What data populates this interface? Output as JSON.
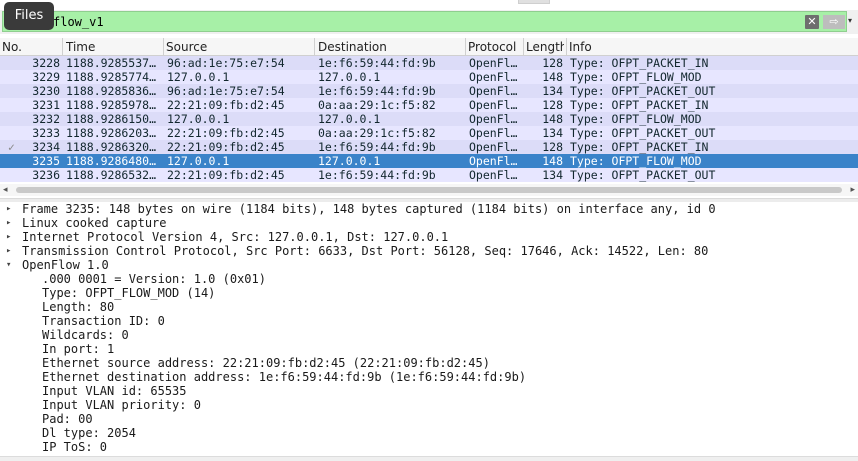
{
  "tooltip": {
    "label": "Files"
  },
  "filter": {
    "value": "flow_v1",
    "clear_icon": "✕",
    "apply_icon": "⇨",
    "dropdown_icon": "▾",
    "bg_color": "#a7f0a7"
  },
  "columns": [
    "No.",
    "Time",
    "Source",
    "Destination",
    "Protocol",
    "Length",
    "Info"
  ],
  "packets": [
    {
      "no": "3228",
      "time": "1188.9285537…",
      "src": "96:ad:1e:75:e7:54",
      "dst": "1e:f6:59:44:fd:9b",
      "proto": "OpenFl…",
      "len": "128",
      "info": "Type: OFPT_PACKET_IN",
      "bg": "#dcdcf8",
      "fg": "#12272e",
      "mark": ""
    },
    {
      "no": "3229",
      "time": "1188.9285774…",
      "src": "127.0.0.1",
      "dst": "127.0.0.1",
      "proto": "OpenFl…",
      "len": "148",
      "info": "Type: OFPT_FLOW_MOD",
      "bg": "#e7e6ff",
      "fg": "#12272e",
      "mark": ""
    },
    {
      "no": "3230",
      "time": "1188.9285836…",
      "src": "96:ad:1e:75:e7:54",
      "dst": "1e:f6:59:44:fd:9b",
      "proto": "OpenFl…",
      "len": "134",
      "info": "Type: OFPT_PACKET_OUT",
      "bg": "#dcdcf8",
      "fg": "#12272e",
      "mark": ""
    },
    {
      "no": "3231",
      "time": "1188.9285978…",
      "src": "22:21:09:fb:d2:45",
      "dst": "0a:aa:29:1c:f5:82",
      "proto": "OpenFl…",
      "len": "128",
      "info": "Type: OFPT_PACKET_IN",
      "bg": "#e7e6ff",
      "fg": "#12272e",
      "mark": ""
    },
    {
      "no": "3232",
      "time": "1188.9286150…",
      "src": "127.0.0.1",
      "dst": "127.0.0.1",
      "proto": "OpenFl…",
      "len": "148",
      "info": "Type: OFPT_FLOW_MOD",
      "bg": "#dcdcf8",
      "fg": "#12272e",
      "mark": ""
    },
    {
      "no": "3233",
      "time": "1188.9286203…",
      "src": "22:21:09:fb:d2:45",
      "dst": "0a:aa:29:1c:f5:82",
      "proto": "OpenFl…",
      "len": "134",
      "info": "Type: OFPT_PACKET_OUT",
      "bg": "#e7e6ff",
      "fg": "#12272e",
      "mark": ""
    },
    {
      "no": "3234",
      "time": "1188.9286320…",
      "src": "22:21:09:fb:d2:45",
      "dst": "1e:f6:59:44:fd:9b",
      "proto": "OpenFl…",
      "len": "128",
      "info": "Type: OFPT_PACKET_IN",
      "bg": "#dcdcf8",
      "fg": "#12272e",
      "mark": "✓"
    },
    {
      "no": "3235",
      "time": "1188.9286480…",
      "src": "127.0.0.1",
      "dst": "127.0.0.1",
      "proto": "OpenFl…",
      "len": "148",
      "info": "Type: OFPT_FLOW_MOD",
      "bg": "#3a83c9",
      "fg": "#ffffff",
      "mark": ""
    },
    {
      "no": "3236",
      "time": "1188.9286532…",
      "src": "22:21:09:fb:d2:45",
      "dst": "1e:f6:59:44:fd:9b",
      "proto": "OpenFl…",
      "len": "134",
      "info": "Type: OFPT_PACKET_OUT",
      "bg": "#e7e6ff",
      "fg": "#12272e",
      "mark": ""
    }
  ],
  "scroll": {
    "left_icon": "◂",
    "right_icon": "▸"
  },
  "details": [
    {
      "toggle": "▸",
      "indent": 0,
      "text": "Frame 3235: 148 bytes on wire (1184 bits), 148 bytes captured (1184 bits) on interface any, id 0"
    },
    {
      "toggle": "▸",
      "indent": 0,
      "text": "Linux cooked capture"
    },
    {
      "toggle": "▸",
      "indent": 0,
      "text": "Internet Protocol Version 4, Src: 127.0.0.1, Dst: 127.0.0.1"
    },
    {
      "toggle": "▸",
      "indent": 0,
      "text": "Transmission Control Protocol, Src Port: 6633, Dst Port: 56128, Seq: 17646, Ack: 14522, Len: 80"
    },
    {
      "toggle": "▾",
      "indent": 0,
      "text": "OpenFlow 1.0"
    },
    {
      "toggle": "",
      "indent": 1,
      "text": ".000 0001 = Version: 1.0 (0x01)"
    },
    {
      "toggle": "",
      "indent": 1,
      "text": "Type: OFPT_FLOW_MOD (14)"
    },
    {
      "toggle": "",
      "indent": 1,
      "text": "Length: 80"
    },
    {
      "toggle": "",
      "indent": 1,
      "text": "Transaction ID: 0"
    },
    {
      "toggle": "",
      "indent": 1,
      "text": "Wildcards: 0"
    },
    {
      "toggle": "",
      "indent": 1,
      "text": "In port: 1"
    },
    {
      "toggle": "",
      "indent": 1,
      "text": "Ethernet source address: 22:21:09:fb:d2:45 (22:21:09:fb:d2:45)"
    },
    {
      "toggle": "",
      "indent": 1,
      "text": "Ethernet destination address: 1e:f6:59:44:fd:9b (1e:f6:59:44:fd:9b)"
    },
    {
      "toggle": "",
      "indent": 1,
      "text": "Input VLAN id: 65535"
    },
    {
      "toggle": "",
      "indent": 1,
      "text": "Input VLAN priority: 0"
    },
    {
      "toggle": "",
      "indent": 1,
      "text": "Pad: 00"
    },
    {
      "toggle": "",
      "indent": 1,
      "text": "Dl type: 2054"
    },
    {
      "toggle": "",
      "indent": 1,
      "text": "IP ToS: 0"
    }
  ]
}
